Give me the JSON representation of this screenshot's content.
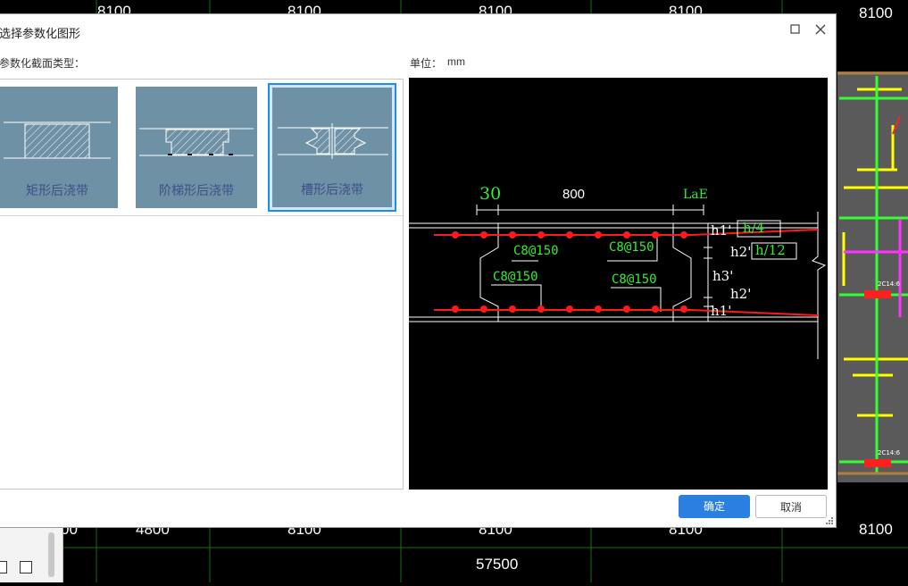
{
  "background": {
    "axis_top": [
      "8100",
      "8100",
      "8100",
      "8100",
      "8100"
    ],
    "axis_bottom": [
      "00",
      "4800",
      "8100",
      "8100",
      "8100",
      "8100"
    ],
    "total_dimension": "57500",
    "rebar_note_1": "2C14:6",
    "rebar_note_2": "2C14:6"
  },
  "dialog": {
    "title": "选择参数化图形",
    "section_type_label": "参数化截面类型：",
    "unit_label": "单位：",
    "unit_value": "mm",
    "cards": [
      {
        "caption": "矩形后浇带",
        "selected": false
      },
      {
        "caption": "阶梯形后浇带",
        "selected": false
      },
      {
        "caption": "槽形后浇带",
        "selected": true
      }
    ],
    "ok_label": "确定",
    "cancel_label": "取消"
  },
  "preview": {
    "dim_30": "30",
    "dim_800": "800",
    "dim_lae": "LaE",
    "rebar_labels": [
      "C8@150",
      "C8@150",
      "C8@150",
      "C8@150"
    ],
    "h1_top": "h1'",
    "h1_top_value": "h/4",
    "h2_top": "h2'",
    "h2_top_value": "h/12",
    "h3": "h3'",
    "h2_bottom": "h2'",
    "h1_bottom": "h1'"
  },
  "colors": {
    "accent": "#2b7fe0",
    "card_fill": "#6e91a6",
    "rebar_dot": "#ff1a1a",
    "label_green": "#33ee33"
  }
}
